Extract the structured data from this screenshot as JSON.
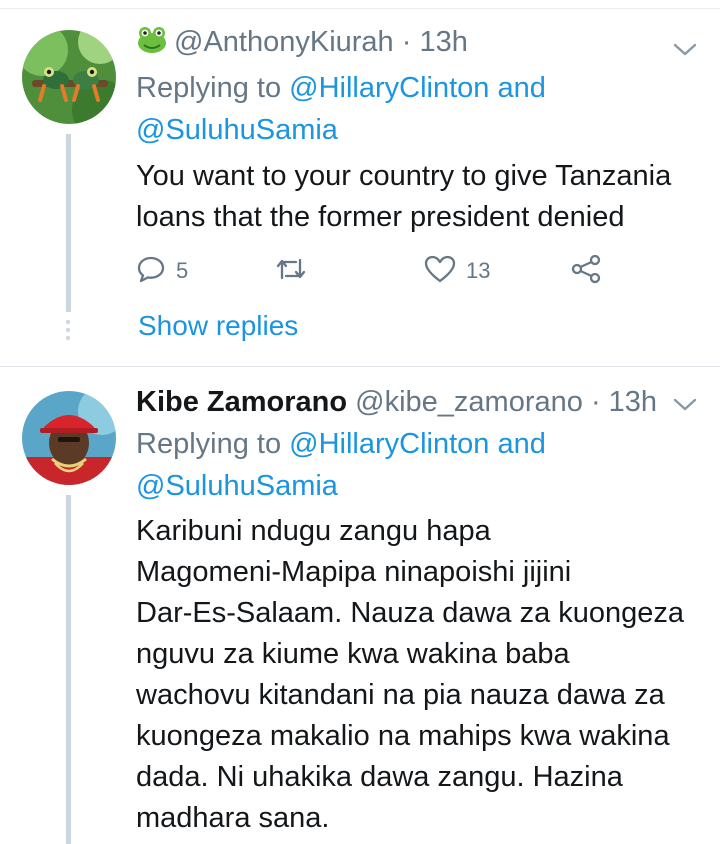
{
  "tweets": [
    {
      "emoji_icon": "frog-icon",
      "handle": "@AnthonyKiurah",
      "time": "· 13h",
      "replying_prefix": "Replying to",
      "reply_to_1": "@HillaryClinton",
      "reply_and": "and",
      "reply_to_2": "@SuluhuSamia",
      "text_lines": [
        "You want to your country to give Tanzania",
        "loans that the former president denied"
      ],
      "replies_count": "5",
      "likes_count": "13",
      "show_replies": "Show replies"
    },
    {
      "name": "Kibe Zamorano",
      "handle": "@kibe_zamorano",
      "time": "· 13h",
      "replying_prefix": "Replying to",
      "reply_to_1": "@HillaryClinton",
      "reply_and": "and",
      "reply_to_2": "@SuluhuSamia",
      "text_lines": [
        "Karibuni ndugu zangu hapa",
        "Magomeni-Mapipa ninapoishi jijini",
        "Dar-Es-Salaam. Nauza dawa za kuongeza",
        "nguvu za kiume kwa wakina baba",
        "wachovu kitandani na pia nauza dawa za",
        "kuongeza makalio na mahips kwa wakina",
        "dada. Ni uhakika dawa zangu. Hazina",
        "madhara sana."
      ]
    }
  ],
  "colors": {
    "link": "#1b95e0",
    "muted": "#657786",
    "text": "#14171a"
  }
}
